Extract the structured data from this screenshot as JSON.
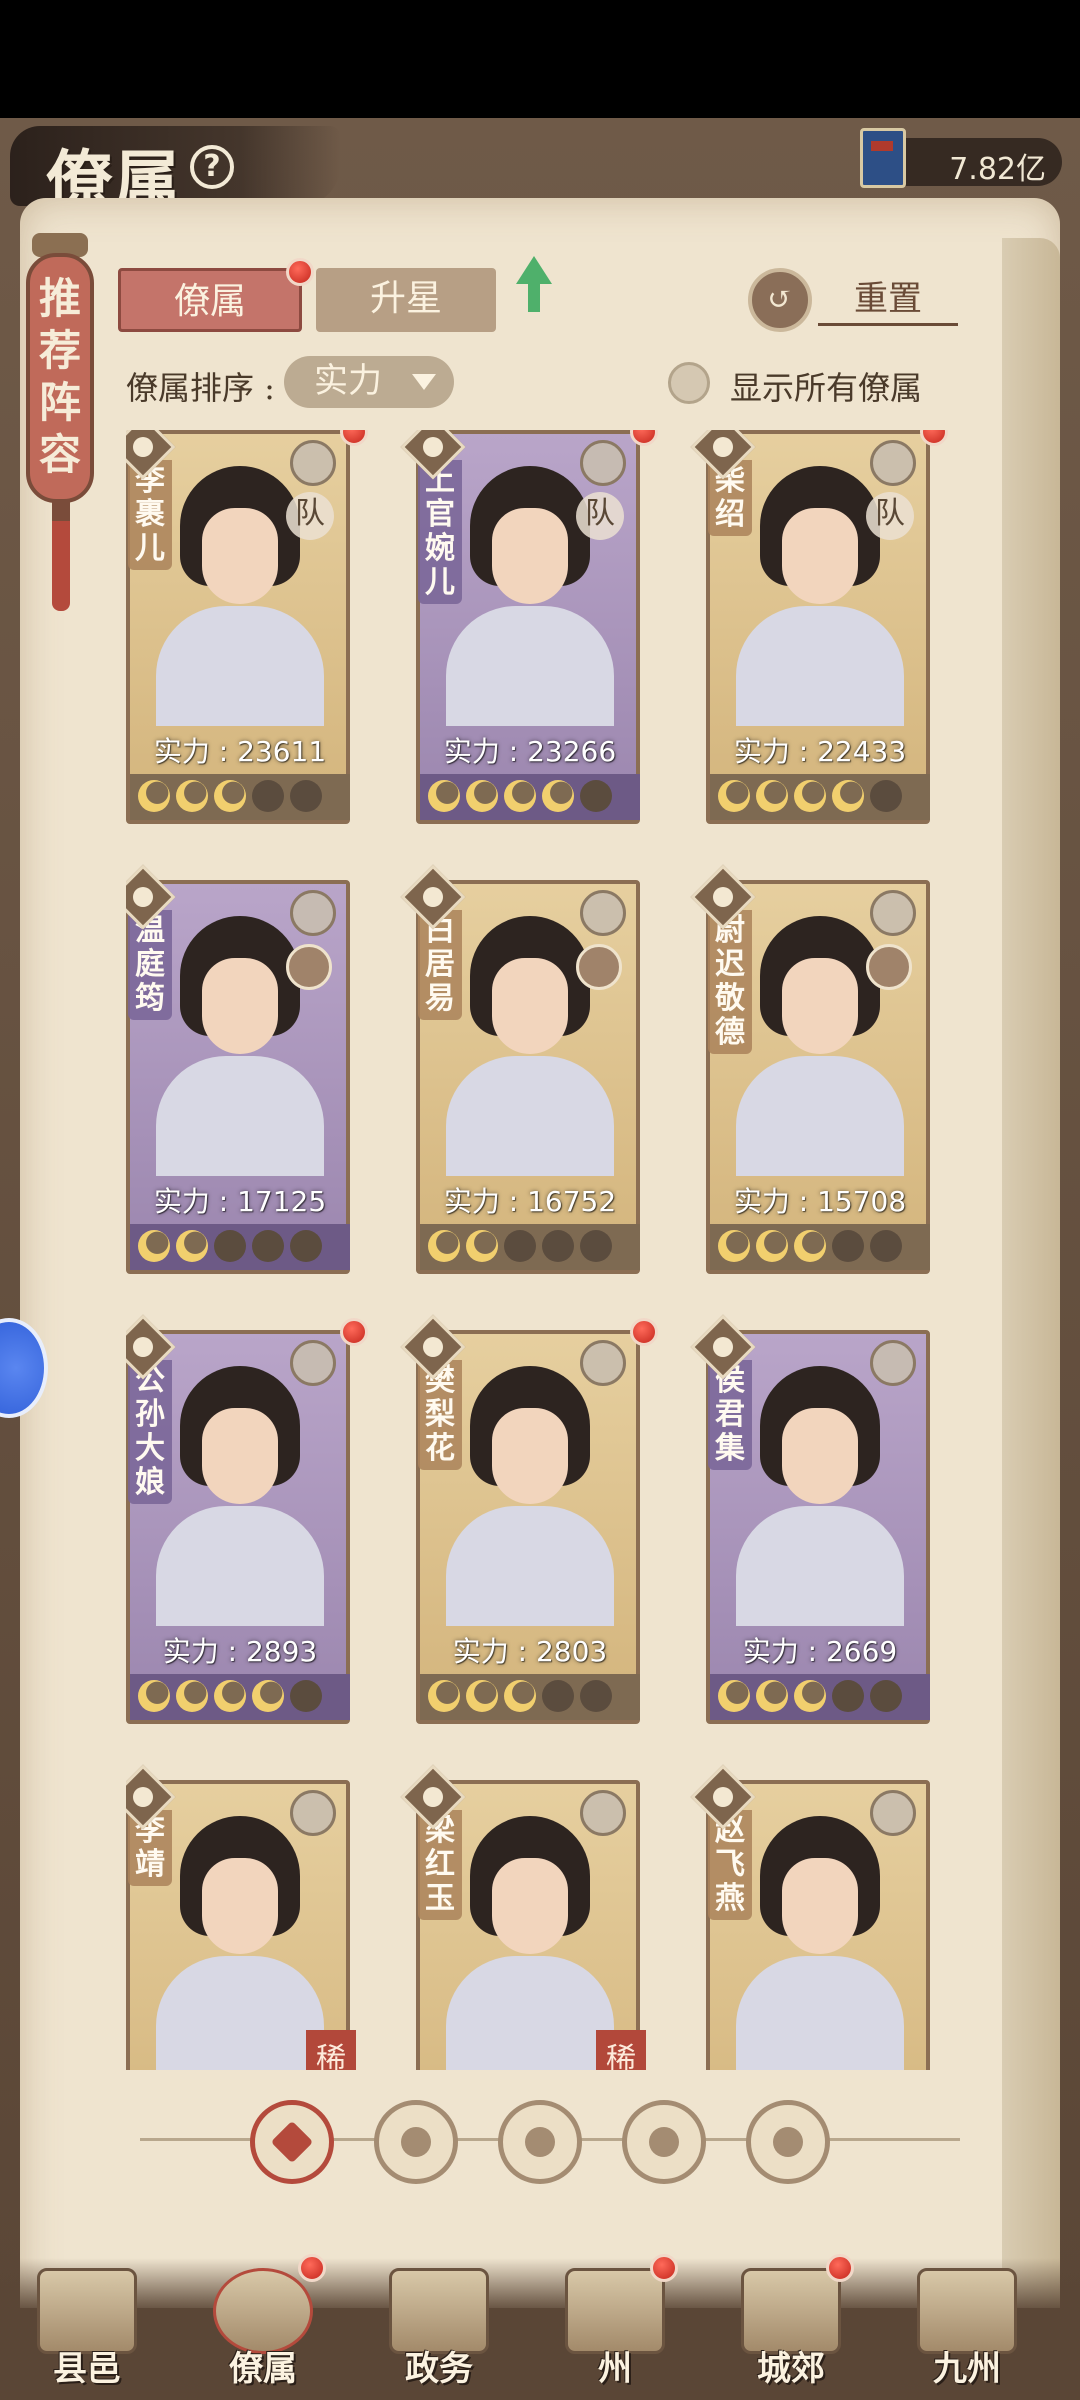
{
  "header": {
    "title": "僚属",
    "help": "?",
    "currency_amount": "7.82亿"
  },
  "ribbon": {
    "text": "推荐阵容"
  },
  "tabs": {
    "active": "僚属",
    "inactive": "升星",
    "reset": "重置"
  },
  "sort": {
    "label": "僚属排序 :",
    "value": "实力",
    "show_all_label": "显示所有僚属"
  },
  "power_label": "实力 :",
  "cards": [
    {
      "name": "李裹儿",
      "power": "23611",
      "stars_filled": 3,
      "theme": "gold",
      "team": "队",
      "dot": true
    },
    {
      "name": "上官婉儿",
      "power": "23266",
      "stars_filled": 4,
      "theme": "purple",
      "team": "队",
      "dot": true
    },
    {
      "name": "柴绍",
      "power": "22433",
      "stars_filled": 4,
      "theme": "gold",
      "team": "队",
      "dot": true
    },
    {
      "name": "温庭筠",
      "power": "17125",
      "stars_filled": 2,
      "theme": "purple",
      "partner": true
    },
    {
      "name": "白居易",
      "power": "16752",
      "stars_filled": 2,
      "theme": "gold",
      "partner": true
    },
    {
      "name": "尉迟敬德",
      "power": "15708",
      "stars_filled": 3,
      "theme": "gold",
      "partner": true
    },
    {
      "name": "公孙大娘",
      "power": "2893",
      "stars_filled": 4,
      "theme": "purple",
      "dot": true
    },
    {
      "name": "樊梨花",
      "power": "2803",
      "stars_filled": 3,
      "theme": "gold",
      "dot": true
    },
    {
      "name": "侯君集",
      "power": "2669",
      "stars_filled": 3,
      "theme": "purple"
    },
    {
      "name": "李靖",
      "power": "",
      "stars_filled": 0,
      "theme": "gold",
      "rare": "稀有"
    },
    {
      "name": "梁红玉",
      "power": "",
      "stars_filled": 0,
      "theme": "gold",
      "rare": "稀有"
    },
    {
      "name": "赵飞燕",
      "power": "",
      "stars_filled": 0,
      "theme": "gold"
    }
  ],
  "filters": [
    "all-filter-icon",
    "bell-filter-icon",
    "cat-filter-icon",
    "fan-filter-icon",
    "lion-filter-icon"
  ],
  "nav": [
    {
      "label": "县邑",
      "dot": false
    },
    {
      "label": "僚属",
      "dot": true,
      "active": true
    },
    {
      "label": "政务",
      "dot": false
    },
    {
      "label": "州",
      "dot": true
    },
    {
      "label": "城郊",
      "dot": true
    },
    {
      "label": "九州",
      "dot": false
    }
  ],
  "colors": {
    "accent_red": "#c4746a",
    "page": "#efe4cf",
    "purple_card": "#9b86ae",
    "gold_card": "#d3b47c"
  }
}
